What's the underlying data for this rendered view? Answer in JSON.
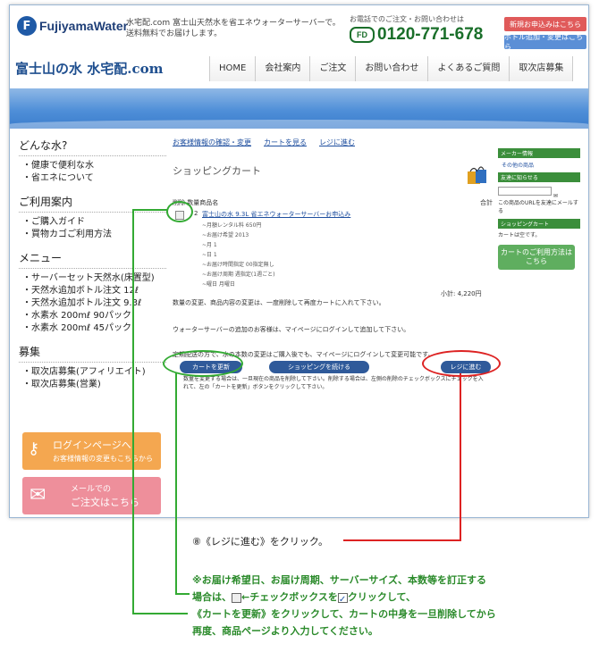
{
  "header": {
    "logo_text": "FujiyamaWater",
    "tagline": "水宅配.com 富士山天然水を省エネウォーターサーバーで。送料無料でお届けします。",
    "tel_note": "お電話でのご注文・お問い合わせは",
    "tel": "0120-771-678",
    "freedial": "FD",
    "btn_apply": "新規お申込みはこちら",
    "btn_bottle": "ボトル追加・変更はこちら",
    "brand": "富士山の水 水宅配.com"
  },
  "nav": [
    "HOME",
    "会社案内",
    "ご注文",
    "お問い合わせ",
    "よくあるご質問",
    "取次店募集"
  ],
  "sidebar": {
    "sections": [
      {
        "title": "どんな水?",
        "items": [
          "健康で便利な水",
          "省エネについて"
        ]
      },
      {
        "title": "ご利用案内",
        "items": [
          "ご購入ガイド",
          "買物カゴご利用方法"
        ]
      },
      {
        "title": "メニュー",
        "items": [
          "サーバーセット天然水(床置型)",
          "天然水追加ボトル注文 12ℓ",
          "天然水追加ボトル注文 9.3ℓ",
          "水素水 200mℓ 90パック",
          "水素水 200mℓ 45パック"
        ]
      },
      {
        "title": "募集",
        "items": [
          "取次店募集(アフィリエイト)",
          "取次店募集(営業)"
        ]
      }
    ],
    "login_title": "ログインページへ",
    "login_sub": "お客様情報の変更もこちらから",
    "mail_title": "メールでの",
    "mail_sub": "ご注文はこちら"
  },
  "main": {
    "links": [
      "お客様情報の確認・変更",
      "カートを見る",
      "レジに進む"
    ],
    "cart_title": "ショッピングカート",
    "th_left": "削除 数量商品名",
    "th_right": "合計",
    "row": {
      "qty": "2",
      "name": "富士山の水 9.3L 省エネウォーターサーバーお申込み",
      "details": [
        "~月額レンタル料 650円",
        "~お届け希望 2013",
        "~月 1",
        "~日 1",
        "~お届け時間指定 00指定無し",
        "~お届け周期 週指定(1週ごと)",
        "~曜日 月曜日"
      ]
    },
    "subtotal": "小計: 4,220円",
    "note1": "数量の変更、商品内容の変更は、一度削除して再度カートに入れて下さい。",
    "note2": "ウォーターサーバーの追加のお客様は、マイページにログインして追加して下さい。",
    "note3": "定期配送の方で、水の本数の変更はご購入後でも、マイページにログインして変更可能です。",
    "btn_update": "カートを更新",
    "btn_continue": "ショッピングを続ける",
    "btn_checkout": "レジに進む",
    "note4": "数量を変更する場合は、一旦現在の商品を削除して下さい。削除する場合は、左側の削除のチェックボックスにチェックを入れて、左の「カートを更新」ボタンをクリックして下さい。"
  },
  "right": {
    "member_head": "メーカー情報",
    "member_link": "その他の商品",
    "friend_head": "友達に知らせる",
    "friend_text": "この商品のURLを友達にメールする",
    "cart_head": "ショッピングカート",
    "cart_empty": "カートは空です。",
    "cart_btn": "カートのご利用方法はこちら"
  },
  "annotations": {
    "step": "⑧《レジに進む》をクリック。",
    "warn_1": "※お届け希望日、お届け周期、サーバーサイズ、本数等を訂正する",
    "warn_2a": "場合は、",
    "warn_2b": "←チェックボックスを",
    "warn_2c": "クリックして、",
    "warn_3": "《カートを更新》をクリックして、カートの中身を一旦削除してから",
    "warn_4": "再度、商品ページより入力してください。"
  },
  "colors": {
    "accent_green": "#33aa33",
    "accent_red": "#dd2222",
    "brand_blue": "#1f4f8f"
  }
}
